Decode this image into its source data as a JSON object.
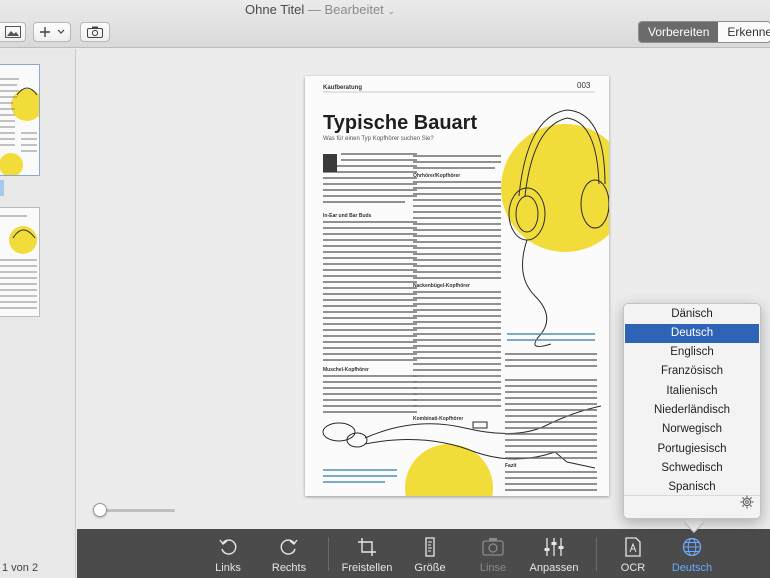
{
  "window": {
    "title": "Ohne Titel",
    "title_separator": " — ",
    "title_state": "Bearbeitet"
  },
  "toolbar": {
    "image_button_icon": "image-icon",
    "add_button_icon": "plus-icon",
    "scan_button_icon": "camera-icon",
    "modes": [
      "Vorbereiten",
      "Erkennen"
    ],
    "active_mode": "Vorbereiten"
  },
  "sidebar": {
    "page_count": "1 von 2"
  },
  "document": {
    "kicker": "Kaufberatung",
    "page_number": "003",
    "headline": "Typische Bauart",
    "subline": "Was für einen Typ Kopfhörer suchen Sie?",
    "body_sections": [
      "In-Ear und Bar Buds",
      "Muschel-Kopfhörer",
      "Ohrhörer/Kopfhörer",
      "Nackenbügel-Kopfhörer",
      "Kombinati-Kopfhörer",
      "Fazit"
    ]
  },
  "bottom_bar": {
    "items": [
      {
        "label": "Links",
        "icon": "rotate-left-icon",
        "state": "normal"
      },
      {
        "label": "Rechts",
        "icon": "rotate-right-icon",
        "state": "normal"
      },
      {
        "label": "Freistellen",
        "icon": "crop-icon",
        "state": "normal"
      },
      {
        "label": "Größe",
        "icon": "size-icon",
        "state": "normal"
      },
      {
        "label": "Linse",
        "icon": "camera-lens-icon",
        "state": "disabled"
      },
      {
        "label": "Anpassen",
        "icon": "sliders-icon",
        "state": "normal"
      },
      {
        "label": "OCR",
        "icon": "ocr-document-icon",
        "state": "normal"
      },
      {
        "label": "Deutsch",
        "icon": "globe-icon",
        "state": "selected"
      }
    ]
  },
  "language_menu": {
    "options": [
      "Dänisch",
      "Deutsch",
      "Englisch",
      "Französisch",
      "Italienisch",
      "Niederländisch",
      "Norwegisch",
      "Portugiesisch",
      "Schwedisch",
      "Spanisch"
    ],
    "selected": "Deutsch",
    "settings_icon": "gear-icon"
  },
  "colors": {
    "accent_selected": "#2f63b6",
    "yellow_highlight": "#f2dc3a",
    "bottom_bar_bg": "#4b4b4b"
  }
}
